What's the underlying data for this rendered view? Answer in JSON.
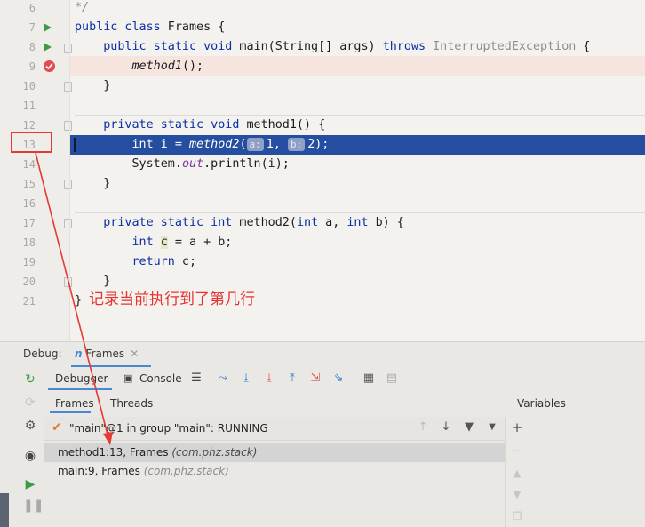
{
  "editor": {
    "line_numbers": [
      "6",
      "7",
      "8",
      "9",
      "10",
      "11",
      "12",
      "13",
      "14",
      "15",
      "16",
      "17",
      "18",
      "19",
      "20",
      "21"
    ],
    "lines": {
      "l6_comment": "*/",
      "l7_kw": "public class",
      "l7_rest": " Frames {",
      "l8_kw": "public static void",
      "l8_name": " main(String[] args) ",
      "l8_throws": "throws",
      "l8_exc": " InterruptedException",
      "l8_end": " {",
      "l9_call": "method1",
      "l9_end": "();",
      "l10": "}",
      "l12_kw": "private static void",
      "l12_rest": " method1() {",
      "l13_kw": "int",
      "l13_mid": " i = ",
      "l13_call": "method2",
      "l13_open": "(",
      "l13_hint_a": "a:",
      "l13_arg1": "1, ",
      "l13_hint_b": "b:",
      "l13_arg2": "2);",
      "l14_pre": "System.",
      "l14_field": "out",
      "l14_post": ".println(i);",
      "l15": "}",
      "l17_kw": "private static int",
      "l17_name": " method2(",
      "l17_int1": "int",
      "l17_a": " a, ",
      "l17_int2": "int",
      "l17_b": " b) {",
      "l18_kw": "int",
      "l18_sp": " ",
      "l18_c": "c",
      "l18_rest": " = a + b;",
      "l19_kw": "return",
      "l19_rest": " c;",
      "l20": "}",
      "l21": "}"
    },
    "annotation": "记录当前执行到了第几行"
  },
  "debug": {
    "label": "Debug:",
    "session_tab": "Frames",
    "subtabs": {
      "debugger": "Debugger",
      "console": "Console"
    },
    "panel_tabs": {
      "frames": "Frames",
      "threads": "Threads"
    },
    "variables_title": "Variables",
    "thread": "\"main\"@1 in group \"main\": RUNNING",
    "frames": [
      {
        "name": "method1:13, Frames ",
        "pkg": "(com.phz.stack)"
      },
      {
        "name": "main:9, Frames ",
        "pkg": "(com.phz.stack)"
      }
    ]
  },
  "colors": {
    "exec_line": "#264ea0",
    "breakpoint": "#e04b54",
    "keyword": "#0b2fa6",
    "annotation": "#e8322f",
    "run_icon": "#3d9b46"
  }
}
